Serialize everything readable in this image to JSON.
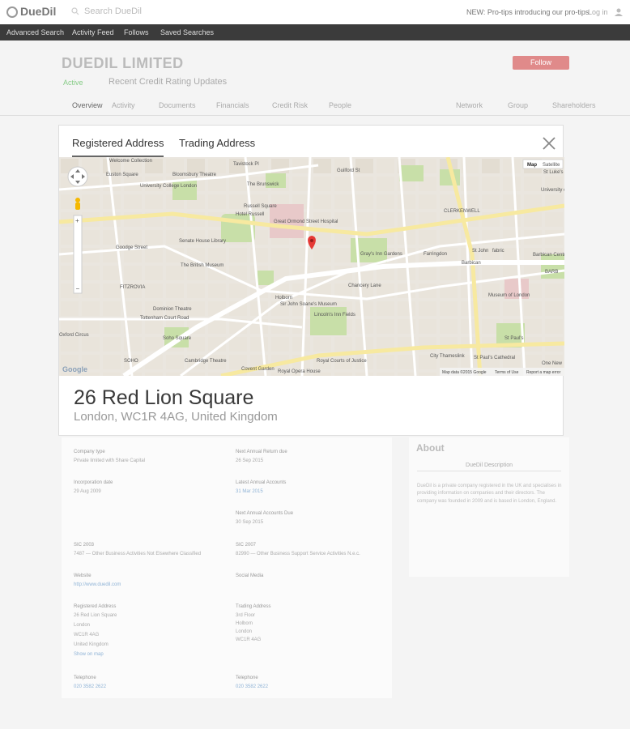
{
  "header": {
    "logo_text": "DueDil",
    "search_placeholder": "Search DueDil",
    "promo": "NEW: Pro-tips introducing our pro-tips",
    "login": "Log in"
  },
  "nav": {
    "items": [
      "Advanced Search",
      "Activity Feed",
      "Follows",
      "Saved Searches"
    ]
  },
  "company": {
    "name": "DUEDIL LIMITED",
    "status": "Active",
    "updates": "Recent Credit Rating Updates",
    "follow_label": "Follow",
    "tabs": [
      "Overview",
      "Activity",
      "Documents",
      "Financials",
      "Credit Risk",
      "People",
      "Network",
      "Group",
      "Shareholders"
    ]
  },
  "details": {
    "company_type_label": "Company type",
    "company_type": "Private limited with Share Capital",
    "incorporation_label": "Incorporation date",
    "incorporation": "29 Aug 2009",
    "next_return_label": "Next Annual Return due",
    "next_return": "26 Sep 2015",
    "latest_accounts_label": "Latest Annual Accounts",
    "latest_accounts": "31 Mar 2015",
    "next_accounts_label": "Next Annual Accounts Due",
    "next_accounts": "30 Sep 2015",
    "sic1_label": "SIC 2003",
    "sic1": "7487 — Other Business Activities Not Elsewhere Classified",
    "sic2_label": "SIC 2007",
    "sic2": "82990 — Other Business Support Service Activities N.e.c.",
    "website_label": "Website",
    "website": "http://www.duedil.com",
    "social_label": "Social Media",
    "reg_address_label": "Registered Address",
    "reg_address": [
      "26 Red Lion Square",
      "London",
      "WC1R 4AG",
      "United Kingdom"
    ],
    "show_map": "Show on map",
    "trading_address_label": "Trading Address",
    "trading_address": [
      "3rd Floor",
      "Holborn",
      "London",
      "WC1R 4AG"
    ],
    "phone_label": "Telephone",
    "phone": "020 3582 2622",
    "phone2_label": "Telephone",
    "phone2": "020 3582 2622"
  },
  "about": {
    "title": "About",
    "desc_label": "DueDil Description",
    "desc": "DueDil is a private company registered in the UK and specialises in providing information on companies and their directors. The company was founded in 2009 and is based in London, England."
  },
  "modal": {
    "tab_registered": "Registered Address",
    "tab_trading": "Trading Address",
    "address_line1": "26 Red Lion Square",
    "address_line2": "London, WC1R 4AG, United Kingdom"
  },
  "map": {
    "type_map": "Map",
    "type_satellite": "Satellite",
    "footer_data": "Map data ©2015 Google",
    "footer_terms": "Terms of Use",
    "footer_report": "Report a map error",
    "google_logo": "Google",
    "labels": [
      "Welcome Collection",
      "Euston Square",
      "Bloomsbury Theatre",
      "University College London",
      "Tavistock Pl",
      "The Brunswick",
      "Guilford St",
      "St Luke's",
      "University of the Arts London",
      "Russell Square",
      "Hotel Russell",
      "Great Ormond Street Hospital",
      "CLERKENWELL",
      "Goodge Street",
      "Senate House Library",
      "The British Museum",
      "Gray's Inn Gardens",
      "Farringdon",
      "St John",
      "Barbican",
      "fabric",
      "Barbican Centre",
      "FITZROVIA",
      "Holborn",
      "Chancery Lane",
      "Dominion Theatre",
      "Tottenham Court Road",
      "Sir John Soane's Museum",
      "Lincoln's Inn Fields",
      "Museum of London",
      "Soho Square",
      "Royal Courts of Justice",
      "City Thameslink",
      "St Paul's",
      "Cambridge Theatre",
      "Covent Garden",
      "Royal Opera House",
      "St Paul's Cathedral",
      "One New",
      "Oxford Circus",
      "SOHO",
      "BARB"
    ]
  },
  "colors": {
    "pin": "#e53935",
    "tab_underline": "#666666",
    "park": "#c8dfa8",
    "block": "#e8e4dc",
    "road": "#ffffff",
    "major_road": "#f7e9a0"
  }
}
